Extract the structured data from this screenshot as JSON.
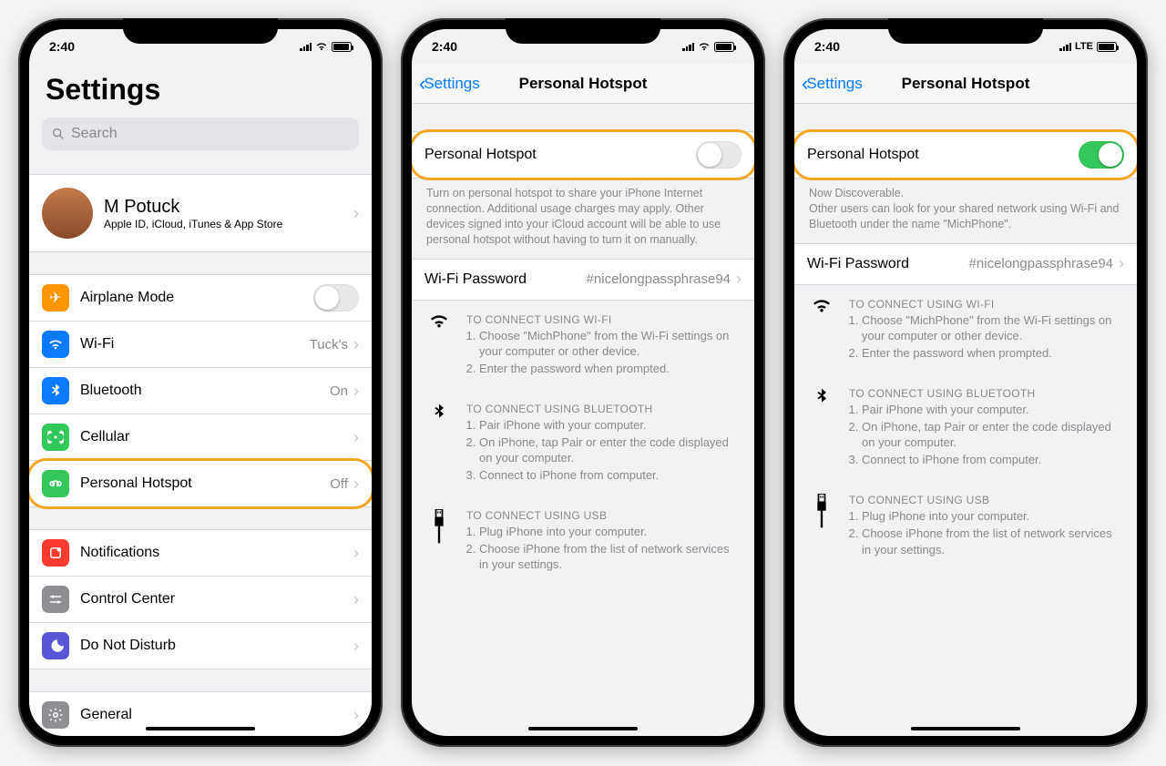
{
  "status": {
    "time": "2:40",
    "lte": "LTE"
  },
  "screen1": {
    "title": "Settings",
    "search_placeholder": "Search",
    "profile": {
      "name": "M Potuck",
      "sub": "Apple ID, iCloud, iTunes & App Store"
    },
    "rows": {
      "airplane": "Airplane Mode",
      "wifi": {
        "label": "Wi-Fi",
        "value": "Tuck's"
      },
      "bluetooth": {
        "label": "Bluetooth",
        "value": "On"
      },
      "cellular": "Cellular",
      "hotspot": {
        "label": "Personal Hotspot",
        "value": "Off"
      },
      "notifications": "Notifications",
      "control": "Control Center",
      "dnd": "Do Not Disturb",
      "general": "General"
    }
  },
  "screen2": {
    "back": "Settings",
    "title": "Personal Hotspot",
    "toggle_label": "Personal Hotspot",
    "hint": "Turn on personal hotspot to share your iPhone Internet connection. Additional usage charges may apply. Other devices signed into your iCloud account will be able to use personal hotspot without having to turn it on manually.",
    "wifi_pw": {
      "label": "Wi-Fi Password",
      "value": "#nicelongpassphrase94"
    }
  },
  "screen3": {
    "back": "Settings",
    "title": "Personal Hotspot",
    "toggle_label": "Personal Hotspot",
    "discover_hd": "Now Discoverable.",
    "discover_body": "Other users can look for your shared network using Wi-Fi and Bluetooth under the name \"MichPhone\".",
    "wifi_pw": {
      "label": "Wi-Fi Password",
      "value": "#nicelongpassphrase94"
    }
  },
  "instructions": {
    "wifi": {
      "hd": "TO CONNECT USING WI-FI",
      "steps": [
        "Choose \"MichPhone\" from the Wi-Fi settings on your computer or other device.",
        "Enter the password when prompted."
      ]
    },
    "bt": {
      "hd": "TO CONNECT USING BLUETOOTH",
      "steps": [
        "Pair iPhone with your computer.",
        "On iPhone, tap Pair or enter the code displayed on your computer.",
        "Connect to iPhone from computer."
      ]
    },
    "usb": {
      "hd": "TO CONNECT USING USB",
      "steps": [
        "Plug iPhone into your computer.",
        "Choose iPhone from the list of network services in your settings."
      ]
    }
  },
  "colors": {
    "airplane": "#ff9500",
    "wifi": "#0a7aff",
    "bluetooth": "#0a7aff",
    "cellular": "#34c759",
    "hotspot": "#34c759",
    "notifications": "#ff3b30",
    "control": "#8e8e93",
    "dnd": "#5856d6",
    "general": "#8e8e93"
  }
}
